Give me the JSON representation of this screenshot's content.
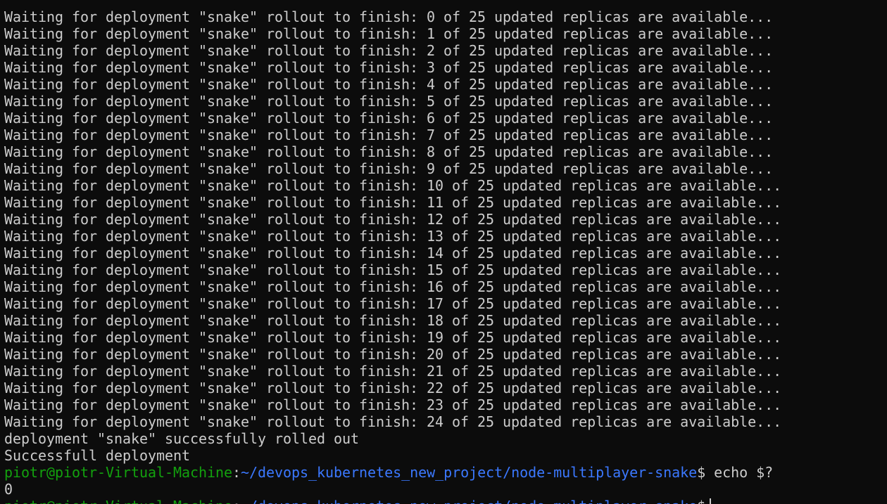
{
  "terminal": {
    "output_lines": [
      "Waiting for deployment \"snake\" rollout to finish: 0 of 25 updated replicas are available...",
      "Waiting for deployment \"snake\" rollout to finish: 1 of 25 updated replicas are available...",
      "Waiting for deployment \"snake\" rollout to finish: 2 of 25 updated replicas are available...",
      "Waiting for deployment \"snake\" rollout to finish: 3 of 25 updated replicas are available...",
      "Waiting for deployment \"snake\" rollout to finish: 4 of 25 updated replicas are available...",
      "Waiting for deployment \"snake\" rollout to finish: 5 of 25 updated replicas are available...",
      "Waiting for deployment \"snake\" rollout to finish: 6 of 25 updated replicas are available...",
      "Waiting for deployment \"snake\" rollout to finish: 7 of 25 updated replicas are available...",
      "Waiting for deployment \"snake\" rollout to finish: 8 of 25 updated replicas are available...",
      "Waiting for deployment \"snake\" rollout to finish: 9 of 25 updated replicas are available...",
      "Waiting for deployment \"snake\" rollout to finish: 10 of 25 updated replicas are available...",
      "Waiting for deployment \"snake\" rollout to finish: 11 of 25 updated replicas are available...",
      "Waiting for deployment \"snake\" rollout to finish: 12 of 25 updated replicas are available...",
      "Waiting for deployment \"snake\" rollout to finish: 13 of 25 updated replicas are available...",
      "Waiting for deployment \"snake\" rollout to finish: 14 of 25 updated replicas are available...",
      "Waiting for deployment \"snake\" rollout to finish: 15 of 25 updated replicas are available...",
      "Waiting for deployment \"snake\" rollout to finish: 16 of 25 updated replicas are available...",
      "Waiting for deployment \"snake\" rollout to finish: 17 of 25 updated replicas are available...",
      "Waiting for deployment \"snake\" rollout to finish: 18 of 25 updated replicas are available...",
      "Waiting for deployment \"snake\" rollout to finish: 19 of 25 updated replicas are available...",
      "Waiting for deployment \"snake\" rollout to finish: 20 of 25 updated replicas are available...",
      "Waiting for deployment \"snake\" rollout to finish: 21 of 25 updated replicas are available...",
      "Waiting for deployment \"snake\" rollout to finish: 22 of 25 updated replicas are available...",
      "Waiting for deployment \"snake\" rollout to finish: 23 of 25 updated replicas are available...",
      "Waiting for deployment \"snake\" rollout to finish: 24 of 25 updated replicas are available...",
      "deployment \"snake\" successfully rolled out",
      "Successfull deployment"
    ],
    "prompt1": {
      "user_host": "piotr@piotr-Virtual-Machine",
      "separator": ":",
      "path": "~/devops_kubernetes_new_project/node-multiplayer-snake",
      "symbol": "$",
      "command": " echo $?"
    },
    "result": "0",
    "prompt2": {
      "user_host": "piotr@piotr-Virtual-Machine",
      "separator": ":",
      "path": "~/devops_kubernetes_new_project/node-multiplayer-snake",
      "symbol": "$"
    },
    "colors": {
      "background": "#0c0c0c",
      "text": "#cccccc",
      "user_host": "#13a10e",
      "path": "#3b78ff"
    }
  }
}
